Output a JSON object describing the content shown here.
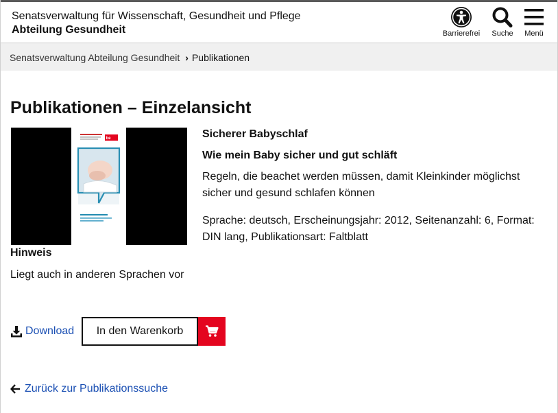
{
  "header": {
    "org_line1": "Senatsverwaltung für Wissenschaft, Gesundheit und Pflege",
    "org_line2": "Abteilung Gesundheit",
    "buttons": [
      {
        "label": "Barrierefrei",
        "icon": "accessibility-icon"
      },
      {
        "label": "Suche",
        "icon": "search-icon"
      },
      {
        "label": "Menü",
        "icon": "menu-icon"
      }
    ]
  },
  "breadcrumb": {
    "items": [
      "Senatsverwaltung Abteilung Gesundheit",
      "Publikationen"
    ]
  },
  "page": {
    "title": "Publikationen – Einzelansicht"
  },
  "publication": {
    "title": "Sicherer Babyschlaf",
    "subtitle": "Wie mein Baby sicher und gut schläft",
    "description": "Regeln, die beachet werden müssen, damit Kleinkinder möglichst sicher und gesund schlafen können",
    "meta": "Sprache: deutsch, Erscheinungsjahr: 2012, Seitenanzahl: 6, Format: DIN lang, Publikationsart: Faltblatt",
    "cover_text": {
      "heading": "Sicherer Babyschlaf",
      "sub": "Wie mein Baby sicher und gut schläft",
      "brand": "be Berlin"
    }
  },
  "hint": {
    "heading": "Hinweis",
    "text": "Liegt auch in anderen Sprachen vor"
  },
  "actions": {
    "download_label": "Download",
    "cart_label": "In den Warenkorb",
    "back_label": "Zurück zur Publikationssuche"
  },
  "colors": {
    "accent_red": "#e4051f",
    "link_blue": "#1a4fb3",
    "cover_teal": "#2a8fb3"
  }
}
